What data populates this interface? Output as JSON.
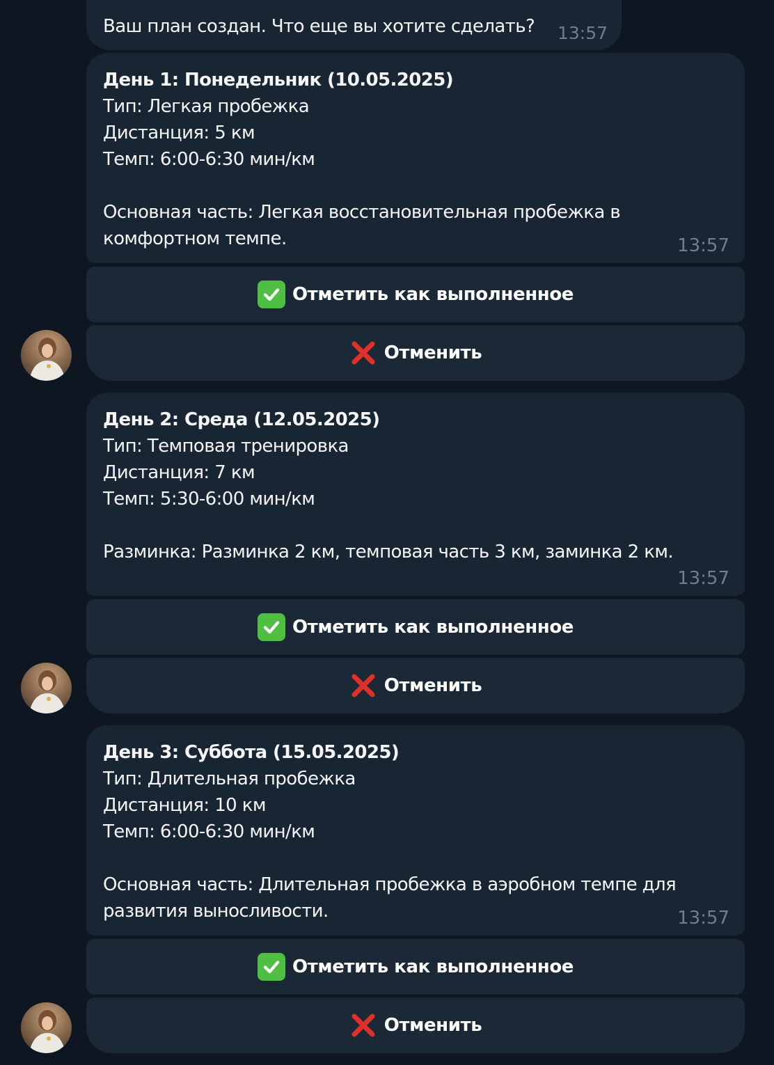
{
  "top_message": {
    "text": "Ваш план создан. Что еще вы хотите сделать?",
    "time": "13:57"
  },
  "days": [
    {
      "title": "День 1: Понедельник (10.05.2025)",
      "type": "Тип: Легкая пробежка",
      "distance": "Дистанция: 5 км",
      "pace": "Темп: 6:00-6:30 мин/км",
      "description": "Основная часть: Легкая восстановительная пробежка в комфортном темпе.",
      "time": "13:57",
      "done_button": "Отметить как выполненное",
      "cancel_button": "Отменить"
    },
    {
      "title": "День 2: Среда (12.05.2025)",
      "type": "Тип: Темповая тренировка",
      "distance": "Дистанция: 7 км",
      "pace": "Темп: 5:30-6:00 мин/км",
      "description": "Разминка: Разминка 2 км, темповая часть 3 км, заминка 2 км.",
      "time": "13:57",
      "done_button": "Отметить как выполненное",
      "cancel_button": "Отменить"
    },
    {
      "title": "День 3: Суббота (15.05.2025)",
      "type": "Тип: Длительная пробежка",
      "distance": "Дистанция: 10 км",
      "pace": "Темп: 6:00-6:30 мин/км",
      "description": "Основная часть: Длительная пробежка в аэробном темпе для развития выносливости.",
      "time": "13:57",
      "done_button": "Отметить как выполненное",
      "cancel_button": "Отменить"
    }
  ],
  "icons": {
    "done": "check-mark-icon",
    "cancel": "cross-mark-icon",
    "avatar": "user-avatar"
  },
  "colors": {
    "background": "#0e1621",
    "bubble": "#182533",
    "button": "#1b2836",
    "check_green": "#4fbf43",
    "cross_red": "#e0302a",
    "timestamp": "#6d7f8f"
  }
}
